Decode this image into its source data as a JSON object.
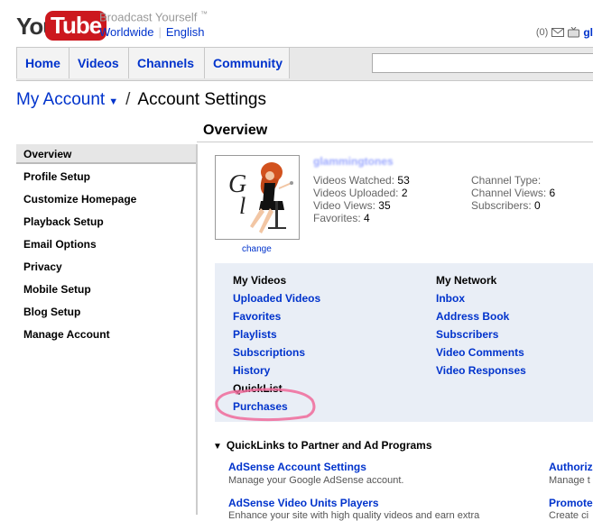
{
  "header": {
    "logo_you": "You",
    "logo_tube": "Tube",
    "tagline": "Broadcast Yourself",
    "tagline_tm": "™",
    "region": "Worldwide",
    "language": "English",
    "inbox_count": "(0)",
    "username_partial": "gl"
  },
  "nav": {
    "tabs": [
      "Home",
      "Videos",
      "Channels",
      "Community"
    ],
    "search_value": ""
  },
  "breadcrumb": {
    "account": "My Account",
    "current": "Account Settings"
  },
  "page_title": "Overview",
  "sidebar": {
    "items": [
      "Overview",
      "Profile Setup",
      "Customize Homepage",
      "Playback Setup",
      "Email Options",
      "Privacy",
      "Mobile Setup",
      "Blog Setup",
      "Manage Account"
    ]
  },
  "profile": {
    "change_label": "change",
    "username": "glammingtones",
    "stats_left": [
      {
        "label": "Videos Watched:",
        "value": "53"
      },
      {
        "label": "Videos Uploaded:",
        "value": "2"
      },
      {
        "label": "Video Views:",
        "value": "35"
      },
      {
        "label": "Favorites:",
        "value": "4"
      }
    ],
    "stats_right": [
      {
        "label": "Channel Type:",
        "value": ""
      },
      {
        "label": "Channel Views:",
        "value": "6"
      },
      {
        "label": "Subscribers:",
        "value": "0"
      }
    ]
  },
  "links": {
    "my_videos": {
      "heading": "My Videos",
      "items": [
        "Uploaded Videos",
        "Favorites",
        "Playlists",
        "Subscriptions",
        "History",
        "QuickList",
        "Purchases"
      ]
    },
    "my_network": {
      "heading": "My Network",
      "items": [
        "Inbox",
        "Address Book",
        "Subscribers",
        "Video Comments",
        "Video Responses"
      ]
    }
  },
  "quicklinks": {
    "heading": "QuickLinks to Partner and Ad Programs",
    "items": [
      {
        "title": "AdSense Account Settings",
        "desc": "Manage your Google AdSense account."
      },
      {
        "title": "AdSense Video Units Players",
        "desc": "Enhance your site with high quality videos and earn extra"
      },
      {
        "title": "Authorize",
        "desc": "Manage t"
      },
      {
        "title": "Promote",
        "desc": "Create ci"
      }
    ]
  },
  "colors": {
    "link": "#0033cc",
    "brand_red": "#cc181e",
    "panel_bg": "#e9eef6",
    "highlight_circle": "#f06a9a"
  }
}
